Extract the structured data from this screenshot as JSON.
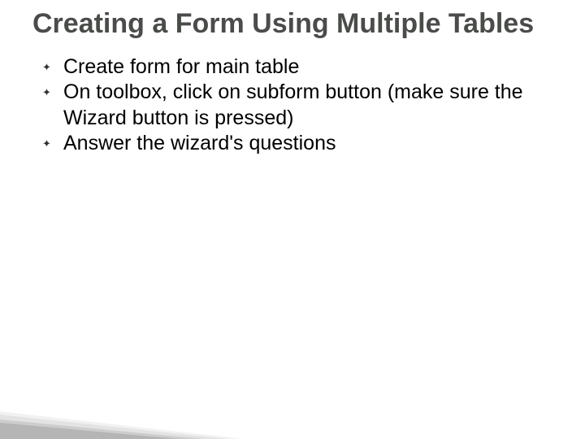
{
  "slide": {
    "title": "Creating a Form Using Multiple Tables",
    "bullets": [
      "Create form for main table",
      "On toolbox, click on subform button (make sure the Wizard button is pressed)",
      "Answer the wizard's questions"
    ]
  }
}
